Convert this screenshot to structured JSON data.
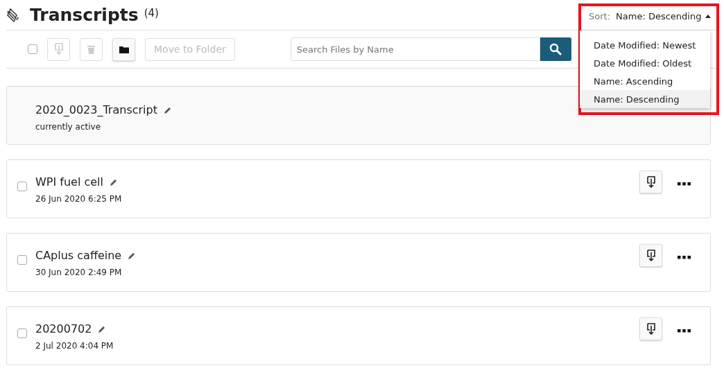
{
  "header": {
    "title": "Transcripts",
    "count": "(4)"
  },
  "toolbar": {
    "select_all_checked": false,
    "download_disabled": true,
    "delete_disabled": true,
    "move_button": {
      "label": "Move to Folder",
      "disabled": true
    },
    "search": {
      "placeholder": "Search Files by Name"
    }
  },
  "sort": {
    "label": "Sort:",
    "value": "Name: Descending",
    "expanded": true,
    "options": [
      {
        "label": "Date Modified: Newest",
        "selected": false
      },
      {
        "label": "Date Modified: Oldest",
        "selected": false
      },
      {
        "label": "Name: Ascending",
        "selected": false
      },
      {
        "label": "Name: Descending",
        "selected": true
      }
    ]
  },
  "files": [
    {
      "name": "2020_0023_Transcript",
      "subtitle": "currently active",
      "active": true
    },
    {
      "name": "WPI fuel cell",
      "subtitle": "26 Jun 2020 6:25 PM",
      "active": false,
      "checked": false
    },
    {
      "name": "CAplus caffeine",
      "subtitle": "30 Jun 2020 2:49 PM",
      "active": false,
      "checked": false
    },
    {
      "name": "20200702",
      "subtitle": "2 Jul 2020 4:04 PM",
      "active": false,
      "checked": false
    }
  ]
}
